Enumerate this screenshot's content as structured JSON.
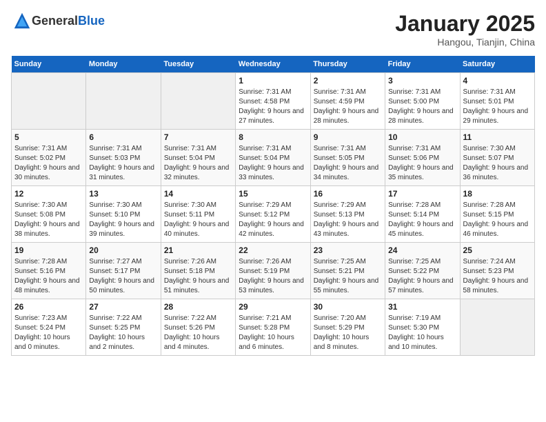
{
  "logo": {
    "general": "General",
    "blue": "Blue"
  },
  "title": "January 2025",
  "location": "Hangou, Tianjin, China",
  "headers": [
    "Sunday",
    "Monday",
    "Tuesday",
    "Wednesday",
    "Thursday",
    "Friday",
    "Saturday"
  ],
  "weeks": [
    [
      {
        "day": "",
        "empty": true
      },
      {
        "day": "",
        "empty": true
      },
      {
        "day": "",
        "empty": true
      },
      {
        "day": "1",
        "sunrise": "7:31 AM",
        "sunset": "4:58 PM",
        "daylight": "9 hours and 27 minutes."
      },
      {
        "day": "2",
        "sunrise": "7:31 AM",
        "sunset": "4:59 PM",
        "daylight": "9 hours and 28 minutes."
      },
      {
        "day": "3",
        "sunrise": "7:31 AM",
        "sunset": "5:00 PM",
        "daylight": "9 hours and 28 minutes."
      },
      {
        "day": "4",
        "sunrise": "7:31 AM",
        "sunset": "5:01 PM",
        "daylight": "9 hours and 29 minutes."
      }
    ],
    [
      {
        "day": "5",
        "sunrise": "7:31 AM",
        "sunset": "5:02 PM",
        "daylight": "9 hours and 30 minutes."
      },
      {
        "day": "6",
        "sunrise": "7:31 AM",
        "sunset": "5:03 PM",
        "daylight": "9 hours and 31 minutes."
      },
      {
        "day": "7",
        "sunrise": "7:31 AM",
        "sunset": "5:04 PM",
        "daylight": "9 hours and 32 minutes."
      },
      {
        "day": "8",
        "sunrise": "7:31 AM",
        "sunset": "5:04 PM",
        "daylight": "9 hours and 33 minutes."
      },
      {
        "day": "9",
        "sunrise": "7:31 AM",
        "sunset": "5:05 PM",
        "daylight": "9 hours and 34 minutes."
      },
      {
        "day": "10",
        "sunrise": "7:31 AM",
        "sunset": "5:06 PM",
        "daylight": "9 hours and 35 minutes."
      },
      {
        "day": "11",
        "sunrise": "7:30 AM",
        "sunset": "5:07 PM",
        "daylight": "9 hours and 36 minutes."
      }
    ],
    [
      {
        "day": "12",
        "sunrise": "7:30 AM",
        "sunset": "5:08 PM",
        "daylight": "9 hours and 38 minutes."
      },
      {
        "day": "13",
        "sunrise": "7:30 AM",
        "sunset": "5:10 PM",
        "daylight": "9 hours and 39 minutes."
      },
      {
        "day": "14",
        "sunrise": "7:30 AM",
        "sunset": "5:11 PM",
        "daylight": "9 hours and 40 minutes."
      },
      {
        "day": "15",
        "sunrise": "7:29 AM",
        "sunset": "5:12 PM",
        "daylight": "9 hours and 42 minutes."
      },
      {
        "day": "16",
        "sunrise": "7:29 AM",
        "sunset": "5:13 PM",
        "daylight": "9 hours and 43 minutes."
      },
      {
        "day": "17",
        "sunrise": "7:28 AM",
        "sunset": "5:14 PM",
        "daylight": "9 hours and 45 minutes."
      },
      {
        "day": "18",
        "sunrise": "7:28 AM",
        "sunset": "5:15 PM",
        "daylight": "9 hours and 46 minutes."
      }
    ],
    [
      {
        "day": "19",
        "sunrise": "7:28 AM",
        "sunset": "5:16 PM",
        "daylight": "9 hours and 48 minutes."
      },
      {
        "day": "20",
        "sunrise": "7:27 AM",
        "sunset": "5:17 PM",
        "daylight": "9 hours and 50 minutes."
      },
      {
        "day": "21",
        "sunrise": "7:26 AM",
        "sunset": "5:18 PM",
        "daylight": "9 hours and 51 minutes."
      },
      {
        "day": "22",
        "sunrise": "7:26 AM",
        "sunset": "5:19 PM",
        "daylight": "9 hours and 53 minutes."
      },
      {
        "day": "23",
        "sunrise": "7:25 AM",
        "sunset": "5:21 PM",
        "daylight": "9 hours and 55 minutes."
      },
      {
        "day": "24",
        "sunrise": "7:25 AM",
        "sunset": "5:22 PM",
        "daylight": "9 hours and 57 minutes."
      },
      {
        "day": "25",
        "sunrise": "7:24 AM",
        "sunset": "5:23 PM",
        "daylight": "9 hours and 58 minutes."
      }
    ],
    [
      {
        "day": "26",
        "sunrise": "7:23 AM",
        "sunset": "5:24 PM",
        "daylight": "10 hours and 0 minutes."
      },
      {
        "day": "27",
        "sunrise": "7:22 AM",
        "sunset": "5:25 PM",
        "daylight": "10 hours and 2 minutes."
      },
      {
        "day": "28",
        "sunrise": "7:22 AM",
        "sunset": "5:26 PM",
        "daylight": "10 hours and 4 minutes."
      },
      {
        "day": "29",
        "sunrise": "7:21 AM",
        "sunset": "5:28 PM",
        "daylight": "10 hours and 6 minutes."
      },
      {
        "day": "30",
        "sunrise": "7:20 AM",
        "sunset": "5:29 PM",
        "daylight": "10 hours and 8 minutes."
      },
      {
        "day": "31",
        "sunrise": "7:19 AM",
        "sunset": "5:30 PM",
        "daylight": "10 hours and 10 minutes."
      },
      {
        "day": "",
        "empty": true
      }
    ]
  ]
}
